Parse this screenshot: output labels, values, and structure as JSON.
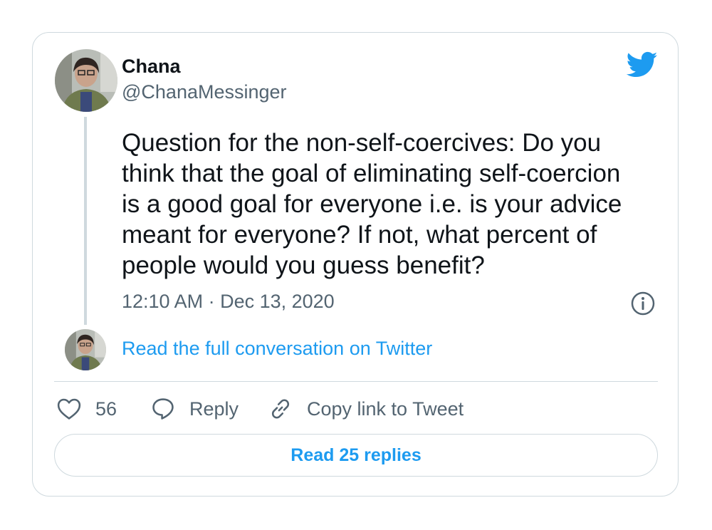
{
  "tweet": {
    "author": {
      "display_name": "Chana",
      "handle": "@ChanaMessinger",
      "avatar_icon": "user-avatar"
    },
    "brand_icon": "twitter-bird-icon",
    "brand_color": "#1d9bf0",
    "text": "Question for the non-self-coercives: Do you\nthink that the goal of eliminating self-coercion\nis a good goal for everyone i.e. is your advice\nmeant for everyone? If not, what percent of\npeople would you guess benefit?",
    "timestamp": "12:10 AM · Dec 13, 2020",
    "info_icon": "info-icon",
    "read_conversation_link": "Read the full conversation on Twitter"
  },
  "actions": {
    "likes": {
      "icon": "heart-icon",
      "count": "56"
    },
    "reply": {
      "icon": "speech-bubble-icon",
      "label": "Reply"
    },
    "copy_link": {
      "icon": "link-icon",
      "label": "Copy link to Tweet"
    }
  },
  "footer": {
    "read_replies_label": "Read 25 replies"
  },
  "colors": {
    "text_primary": "#0f1419",
    "text_secondary": "#536471",
    "accent": "#1d9bf0",
    "border": "#cfd9de"
  }
}
